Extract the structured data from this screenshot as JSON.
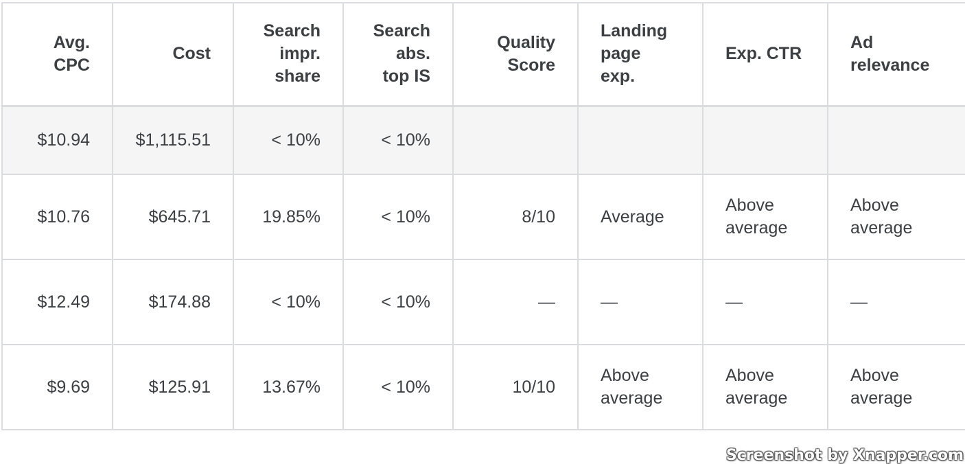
{
  "table": {
    "headers": [
      {
        "lines": [
          "Avg.",
          "CPC"
        ],
        "align": "right"
      },
      {
        "lines": [
          "Cost"
        ],
        "align": "right"
      },
      {
        "lines": [
          "Search",
          "impr.",
          "share"
        ],
        "align": "right"
      },
      {
        "lines": [
          "Search",
          "abs.",
          "top IS"
        ],
        "align": "right"
      },
      {
        "lines": [
          "Quality",
          "Score"
        ],
        "align": "right"
      },
      {
        "lines": [
          "Landing",
          "page",
          "exp."
        ],
        "align": "left"
      },
      {
        "lines": [
          "Exp. CTR"
        ],
        "align": "left"
      },
      {
        "lines": [
          "Ad",
          "relevance"
        ],
        "align": "left"
      }
    ],
    "total_row": [
      "$10.94",
      "$1,115.51",
      "< 10%",
      "< 10%",
      "",
      "",
      "",
      ""
    ],
    "rows": [
      [
        "$10.76",
        "$645.71",
        "19.85%",
        "< 10%",
        "8/10",
        "Average",
        "Above average",
        "Above average"
      ],
      [
        "$12.49",
        "$174.88",
        "< 10%",
        "< 10%",
        "—",
        "—",
        "—",
        "—"
      ],
      [
        "$9.69",
        "$125.91",
        "13.67%",
        "< 10%",
        "10/10",
        "Above average",
        "Above average",
        "Above average"
      ]
    ]
  },
  "watermark": "Screenshot by Xnapper.com"
}
